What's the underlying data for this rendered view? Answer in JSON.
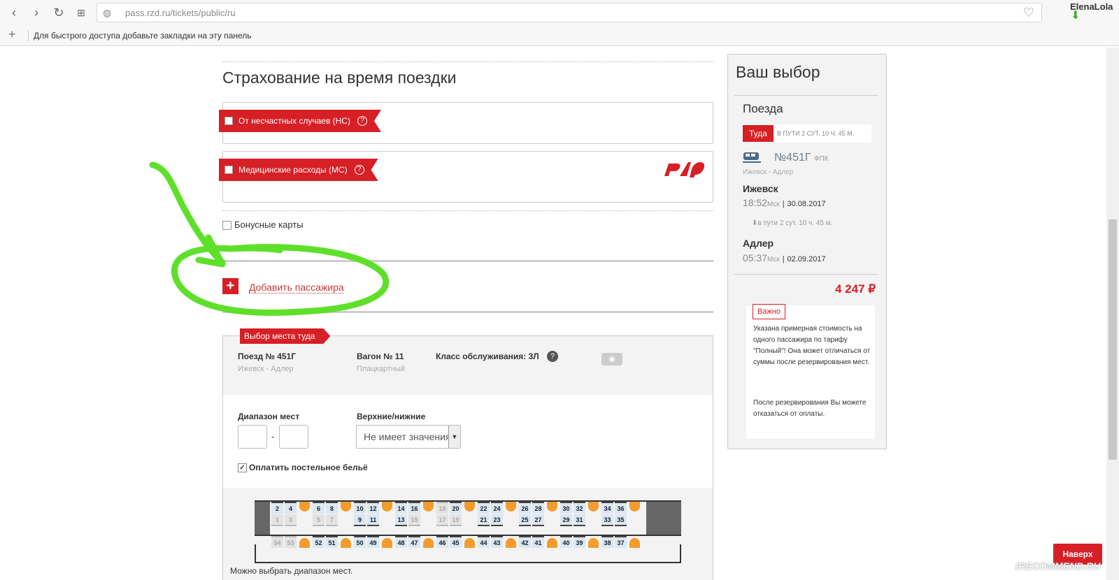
{
  "browser": {
    "url": "pass.rzd.ru/tickets/public/ru",
    "user": "ElenaLola",
    "bookmarks_hint": "Для быстрого доступа добавьте закладки на эту панель"
  },
  "insurance": {
    "title": "Страхование на время поездки",
    "accident": "От несчастных случаев (НС)",
    "medical": "Медицинские расходы (МС)",
    "logo": "РЖД"
  },
  "bonus_cards": "Бонусные карты",
  "add_passenger": "Добавить пассажира",
  "seat_selection": {
    "ribbon": "Выбор места туда",
    "train_label": "Поезд № 451Г",
    "train_route": "Ижевск - Адлер",
    "wagon_label": "Вагон № 11",
    "wagon_type": "Плацкартный",
    "service_class": "Класс обслуживания: 3Л",
    "range_label": "Диапазон мест",
    "berth_label": "Верхние/нижние",
    "berth_value": "Не имеет значения",
    "linen": "Оплатить постельное бельё",
    "range_hint": "Можно выбрать диапазон мест.",
    "wagon_map": {
      "top_upper": [
        "2",
        "4",
        "6",
        "8",
        "10",
        "12",
        "14",
        "16",
        "18",
        "20",
        "22",
        "24",
        "26",
        "28",
        "30",
        "32",
        "34",
        "36"
      ],
      "top_lower": [
        "1",
        "3",
        "5",
        "7",
        "9",
        "11",
        "13",
        "15",
        "17",
        "19",
        "21",
        "23",
        "25",
        "27",
        "29",
        "31",
        "33",
        "35"
      ],
      "side": [
        "54",
        "53",
        "52",
        "51",
        "50",
        "49",
        "48",
        "47",
        "46",
        "45",
        "44",
        "43",
        "42",
        "41",
        "40",
        "39",
        "38",
        "37"
      ],
      "occupied": [
        "1",
        "3",
        "5",
        "7",
        "15",
        "17",
        "18",
        "19",
        "53",
        "54"
      ]
    }
  },
  "sidebar": {
    "title": "Ваш выбор",
    "trains": "Поезда",
    "direction": "Туда",
    "duration_header": "В ПУТИ  2 СУТ. 10 Ч. 45 М.",
    "train_no": "№451Г",
    "train_class": "ФПК",
    "route": "Ижевск - Адлер",
    "from_city": "Ижевск",
    "from_time": "18:52",
    "from_tz": "Мск",
    "from_date": "30.08.2017",
    "en_route": "в пути  2 сут. 10 ч. 45 м.",
    "to_city": "Адлер",
    "to_time": "05:37",
    "to_tz": "Мск",
    "to_date": "02.09.2017",
    "price": "4 247 ₽",
    "important": "Важно",
    "note1": "Указана примерная стоимость на одного пассажира по тарифу \"Полный\"! Она может отличаться от суммы после резервирования мест.",
    "note2": "После резервирования Вы можете отказаться от оплаты."
  },
  "back_to_top": "Наверх",
  "watermark": "IRECOMMEND.RU",
  "colors": {
    "accent": "#d71f26",
    "annotation": "#5ee02a"
  }
}
